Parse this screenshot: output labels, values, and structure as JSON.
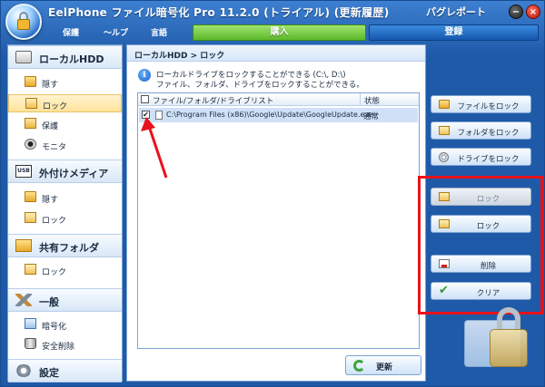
{
  "window": {
    "title": "EelPhone ファイル暗号化 Pro 11.2.0 (トライアル) (更新履歴)",
    "register_link": "パグレポート",
    "minimize": "−",
    "close": "×"
  },
  "menu": {
    "items": [
      "保護",
      "〜ルプ",
      "言語"
    ],
    "buy_label": "購入",
    "register_label": "登録"
  },
  "sidebar": {
    "sections": [
      {
        "label": "ローカルHDD",
        "icon": "hdd-icon",
        "items": [
          {
            "label": "隠す",
            "icon": "folder-hide-icon"
          },
          {
            "label": "ロック",
            "icon": "folder-lock-icon",
            "selected": true
          },
          {
            "label": "保護",
            "icon": "folder-protect-icon"
          },
          {
            "label": "モニタ",
            "icon": "camera-icon"
          }
        ]
      },
      {
        "label": "外付けメディア",
        "icon": "usb-icon",
        "usb_text": "USB",
        "items": [
          {
            "label": "隠す",
            "icon": "folder-hide-icon"
          },
          {
            "label": "ロック",
            "icon": "folder-lock-icon"
          }
        ]
      },
      {
        "label": "共有フォルダ",
        "icon": "shared-folder-icon",
        "items": [
          {
            "label": "ロック",
            "icon": "folder-lock-icon"
          }
        ]
      },
      {
        "label": "一般",
        "icon": "tools-icon",
        "items": [
          {
            "label": "暗号化",
            "icon": "encrypt-icon"
          },
          {
            "label": "安全削除",
            "icon": "trash-icon"
          }
        ]
      },
      {
        "label": "設定",
        "icon": "gear-icon",
        "items": []
      }
    ]
  },
  "main": {
    "breadcrumb": "ローカルHDD > ロック",
    "info_line1": "ローカルドライブをロックすることができる (C:\\, D:\\)",
    "info_line2": "ファイル、フォルダ、ドライブをロックすることができる。",
    "table": {
      "col_path": "ファイル/フォルダ/ドライブリスト",
      "col_status": "状態",
      "rows": [
        {
          "checked": true,
          "path": "C:\\Program Files (x86)\\Google\\Update\\GoogleUpdate.exe",
          "status": "通常"
        }
      ]
    },
    "refresh_label": "更新"
  },
  "actions": {
    "lock_file": "ファイルをロック",
    "lock_folder": "フォルダをロック",
    "lock_drive": "ドライブをロック",
    "lock_disabled": "ロック",
    "lock": "ロック",
    "delete": "削除",
    "clear": "クリア"
  },
  "colors": {
    "accent": "#1f5aa8",
    "buy": "#5cb82b",
    "highlight": "#e8121b"
  }
}
